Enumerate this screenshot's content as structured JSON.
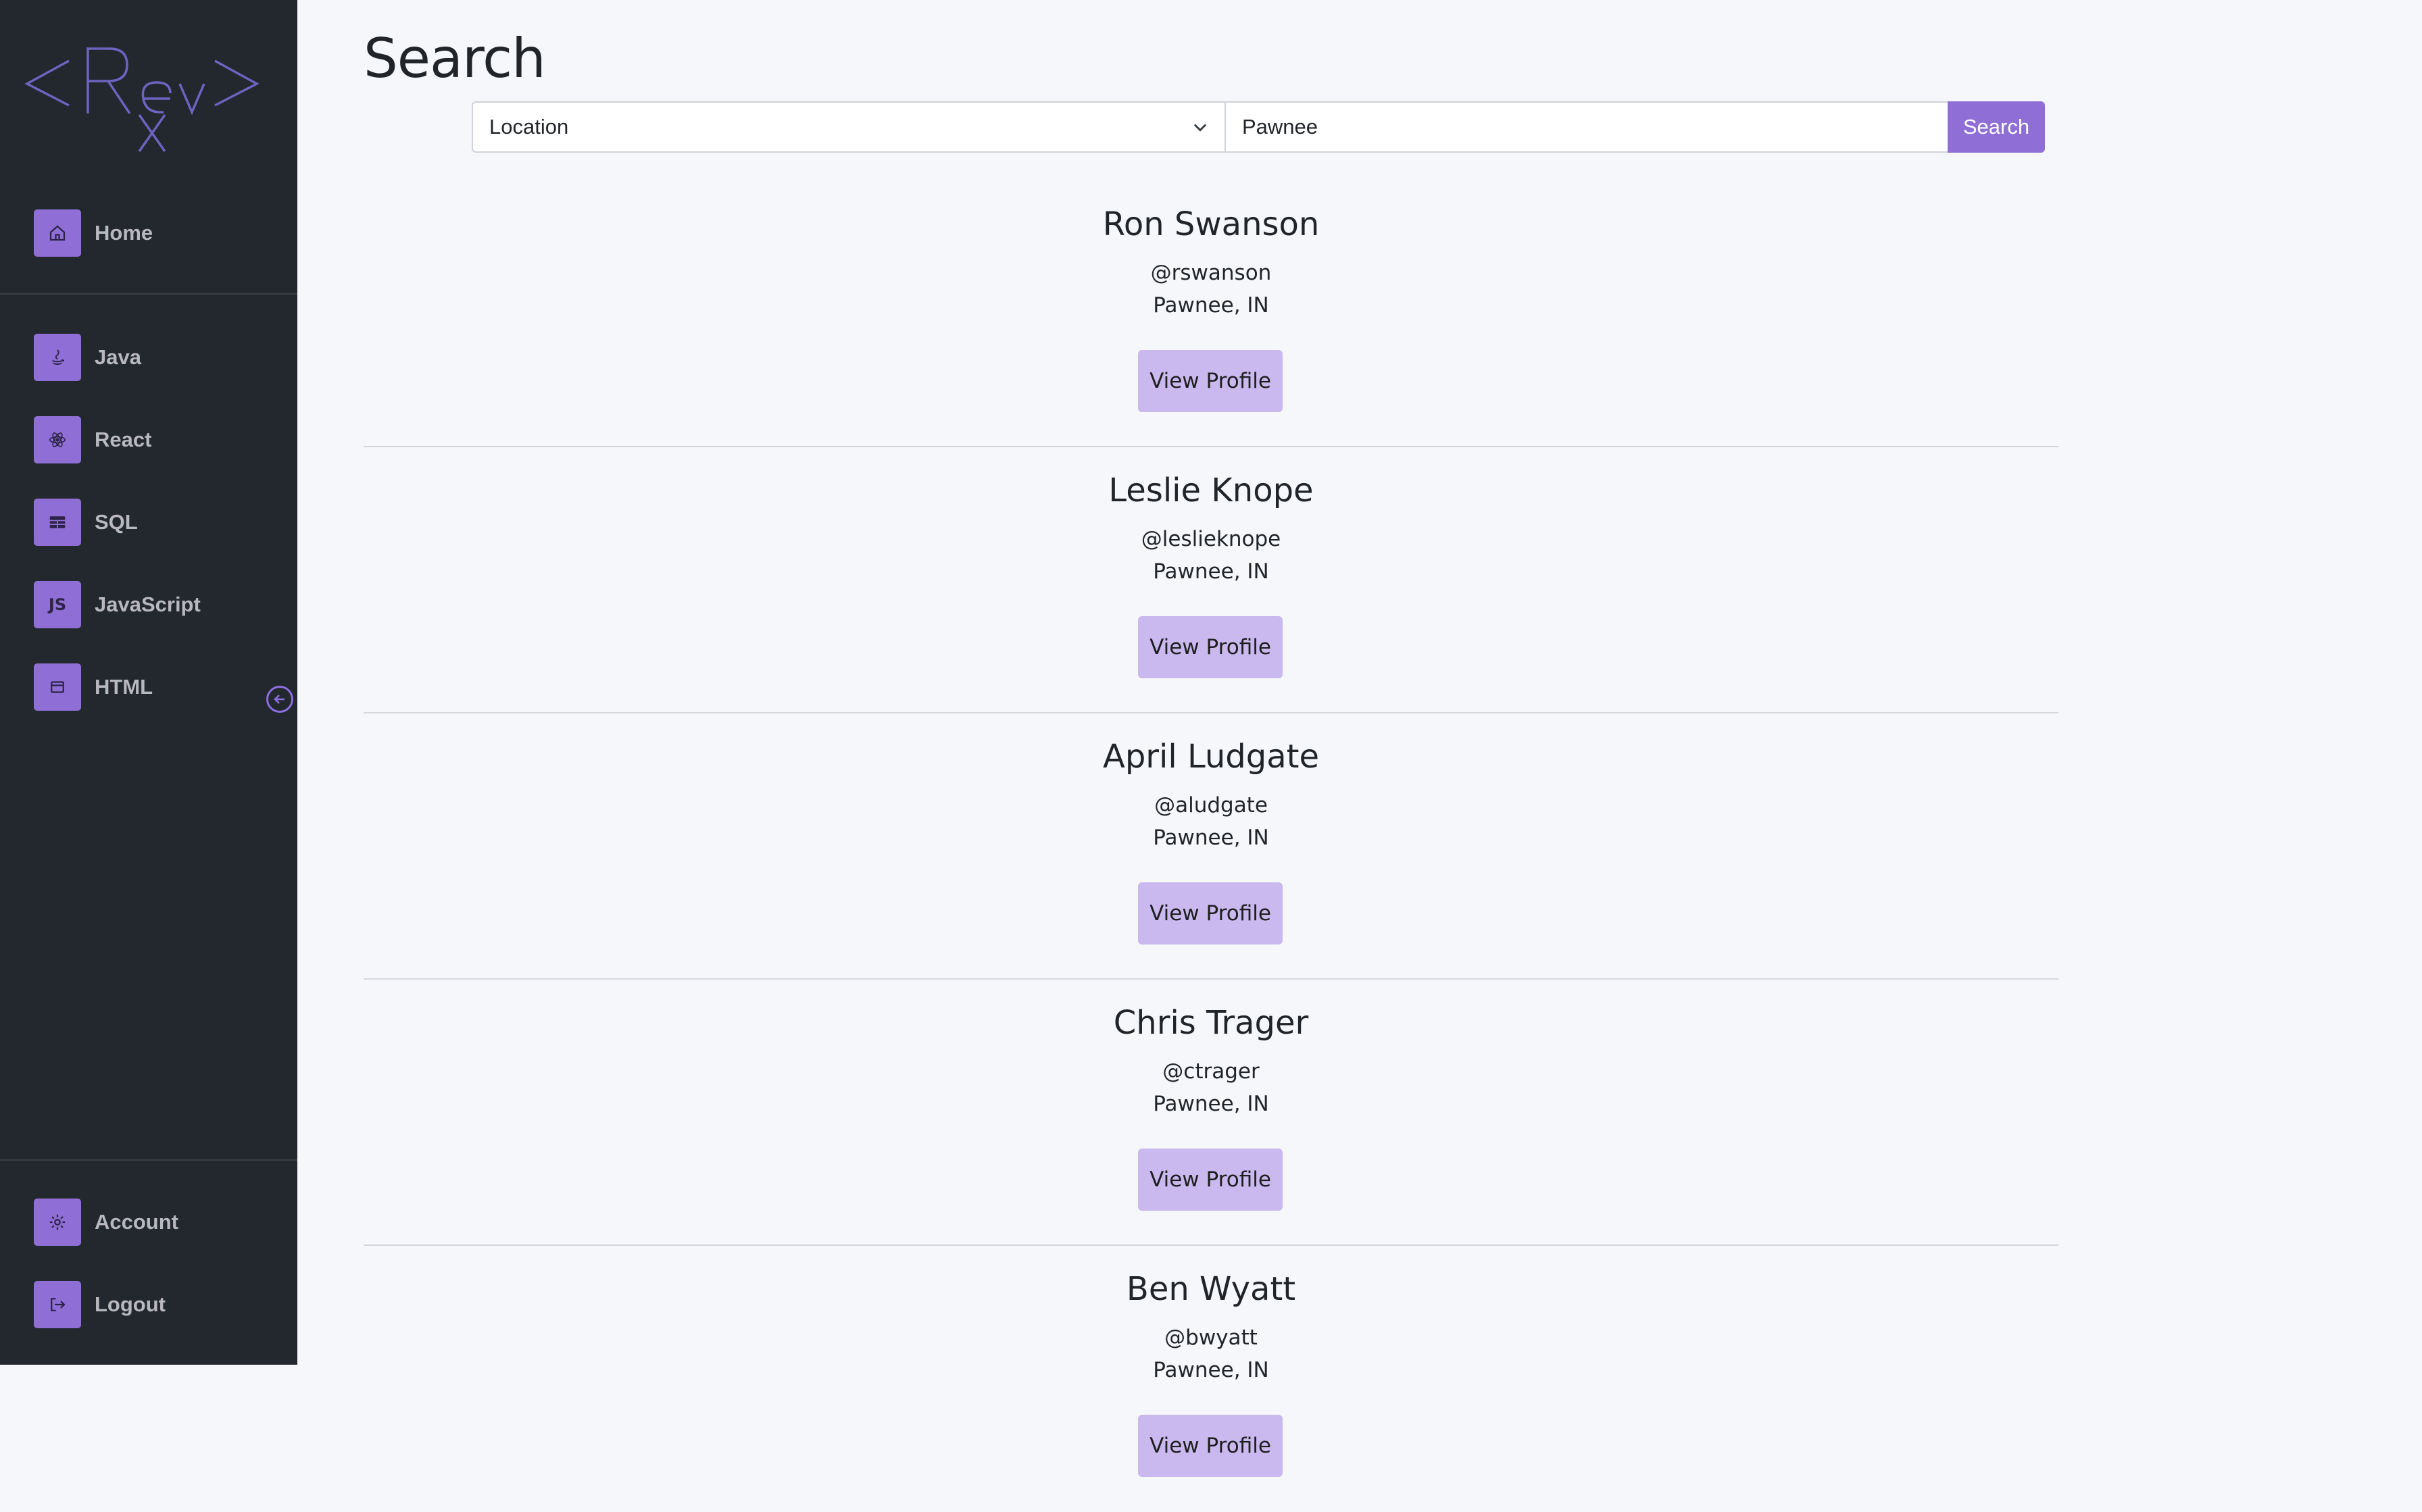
{
  "sidebar": {
    "nav": [
      {
        "label": "Home",
        "icon": "home-icon"
      },
      {
        "label": "Java",
        "icon": "java-icon"
      },
      {
        "label": "React",
        "icon": "react-icon"
      },
      {
        "label": "SQL",
        "icon": "table-icon"
      },
      {
        "label": "JavaScript",
        "icon": "js-icon"
      },
      {
        "label": "HTML",
        "icon": "window-icon"
      }
    ],
    "js_icon_text": "JS",
    "account": {
      "label": "Account",
      "icon": "gear-icon"
    },
    "logout": {
      "label": "Logout",
      "icon": "logout-icon"
    }
  },
  "main": {
    "title": "Search",
    "search": {
      "filter_value": "Location",
      "query_value": "Pawnee",
      "button_label": "Search"
    },
    "results": [
      {
        "name": "Ron Swanson",
        "handle": "@rswanson",
        "location": "Pawnee, IN",
        "button": "View Profile"
      },
      {
        "name": "Leslie Knope",
        "handle": "@leslieknope",
        "location": "Pawnee, IN",
        "button": "View Profile"
      },
      {
        "name": "April Ludgate",
        "handle": "@aludgate",
        "location": "Pawnee, IN",
        "button": "View Profile"
      },
      {
        "name": "Chris Trager",
        "handle": "@ctrager",
        "location": "Pawnee, IN",
        "button": "View Profile"
      },
      {
        "name": "Ben Wyatt",
        "handle": "@bwyatt",
        "location": "Pawnee, IN",
        "button": "View Profile"
      }
    ]
  },
  "colors": {
    "sidebar_bg": "#23272e",
    "accent": "#8f6fd6",
    "profile_button": "#c9b9ef",
    "page_bg": "#f6f7fb"
  }
}
